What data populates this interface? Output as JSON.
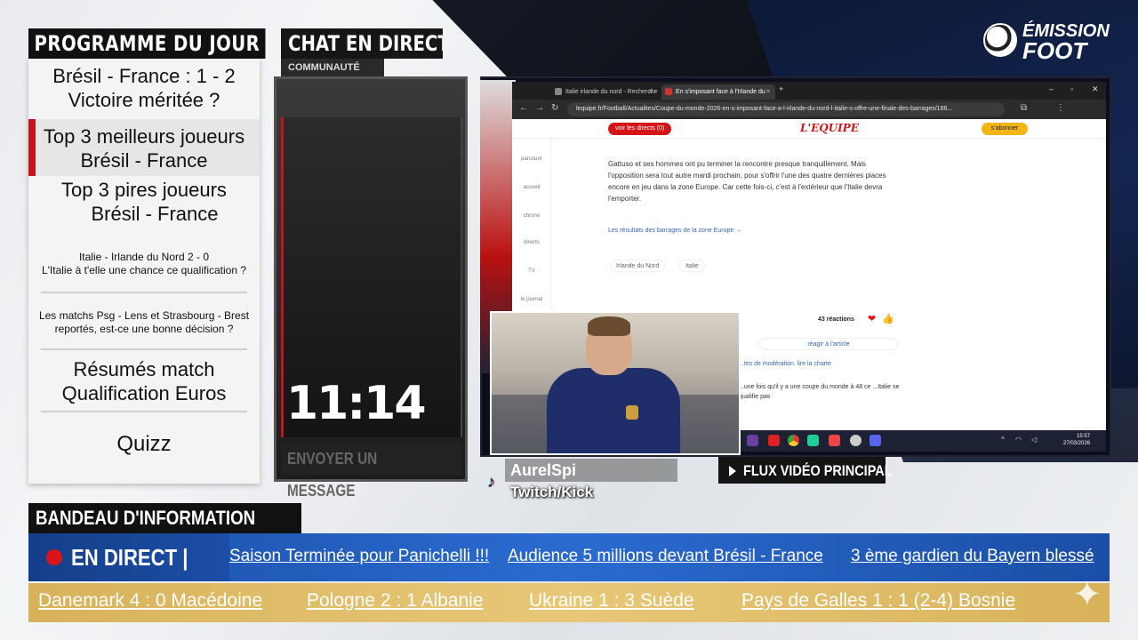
{
  "programme": {
    "title": "PROGRAMME DU JOUR",
    "items": [
      {
        "line1": "Brésil - France : 1 - 2",
        "line2": "Victoire méritée ?"
      },
      {
        "line1": "Top 3 meilleurs joueurs",
        "line2": "Brésil - France"
      },
      {
        "line1": "Top 3 pires joueurs",
        "line2": "Brésil - France"
      },
      {
        "line1": "Italie - Irlande du Nord   2 - 0",
        "line2": "L'Italie à t'elle une chance ce qualification ?"
      },
      {
        "line1": "Les matchs Psg - Lens et Strasbourg - Brest",
        "line2": "reportés, est-ce une bonne décision ?"
      },
      {
        "line1": "Résumés match",
        "line2": "Qualification Euros"
      },
      {
        "line1": "Quizz"
      }
    ]
  },
  "chat": {
    "title": "CHAT EN DIRECT",
    "subtitle": "COMMUNAUTÉ",
    "clock": "11:14",
    "send_label": "ENVOYER UN MESSAGE"
  },
  "logo": {
    "line1": "ÉMISSION",
    "line2": "FOOT"
  },
  "browser": {
    "tabs": [
      {
        "title": "Italie irlande du nord - Recherche",
        "active": false
      },
      {
        "title": "En s'imposant face à l'Irlande du",
        "active": true
      }
    ],
    "url": "lequipe.fr/Football/Actualites/Coupe-du-monde-2026-en-s-imposant-face-a-l-irlande-du-nord-l-italie-s-offre-une-finale-des-barrages/166...",
    "page": {
      "directs_button": "voir les directs (0)",
      "site_logo": "L'EQUIPE",
      "subscribe_button": "s'abonner",
      "sidebar": [
        "parcourir",
        "accueil",
        "chrono",
        "directs",
        "TV",
        "le journal"
      ],
      "paragraph": "Gattuso et ses hommes ont pu terminer la rencontre presque tranquillement. Mais l'opposition sera tout autre mardi prochain, pour s'offrir l'une des quatre dernières places encore en jeu dans la zone Europe. Car cette fois-ci, c'est à l'extérieur que l'Italie devra l'emporter.",
      "link": "Les résultats des barrages de la zone Europe →",
      "tags": [
        "Irlande du Nord",
        "Italie"
      ],
      "reactions": "43 réactions",
      "react_button": "réagir à l'article",
      "moderation": "...tes de modération. lire la charte",
      "comment": "...une fois qu'il y a une coupe du monde à 48 ce ...Italie se qualifie pas"
    },
    "taskbar": {
      "time": "15:57",
      "date": "27/03/2026"
    }
  },
  "streamer": {
    "name": "AurelSpi",
    "platforms": "Twitch/Kick"
  },
  "main_feed_label": "FLUX VIDÉO PRINCIPAL",
  "bandeau": {
    "title": "BANDEAU D'INFORMATION",
    "live_label": "EN DIRECT |",
    "news": [
      "Saison Terminée pour Panichelli !!!",
      "Audience 5 millions devant Brésil - France",
      "3 ème gardien du Bayern blessé"
    ],
    "scores": [
      "Danemark 4 : 0 Macédoine",
      "Pologne 2 : 1 Albanie",
      "Ukraine 1 : 3 Suède",
      "Pays de Galles 1 : 1 (2-4) Bosnie"
    ]
  },
  "colors": {
    "accent_red": "#c5141b",
    "ticker_blue": "#1b4ea6",
    "scores_gold": "#d8b25a"
  }
}
